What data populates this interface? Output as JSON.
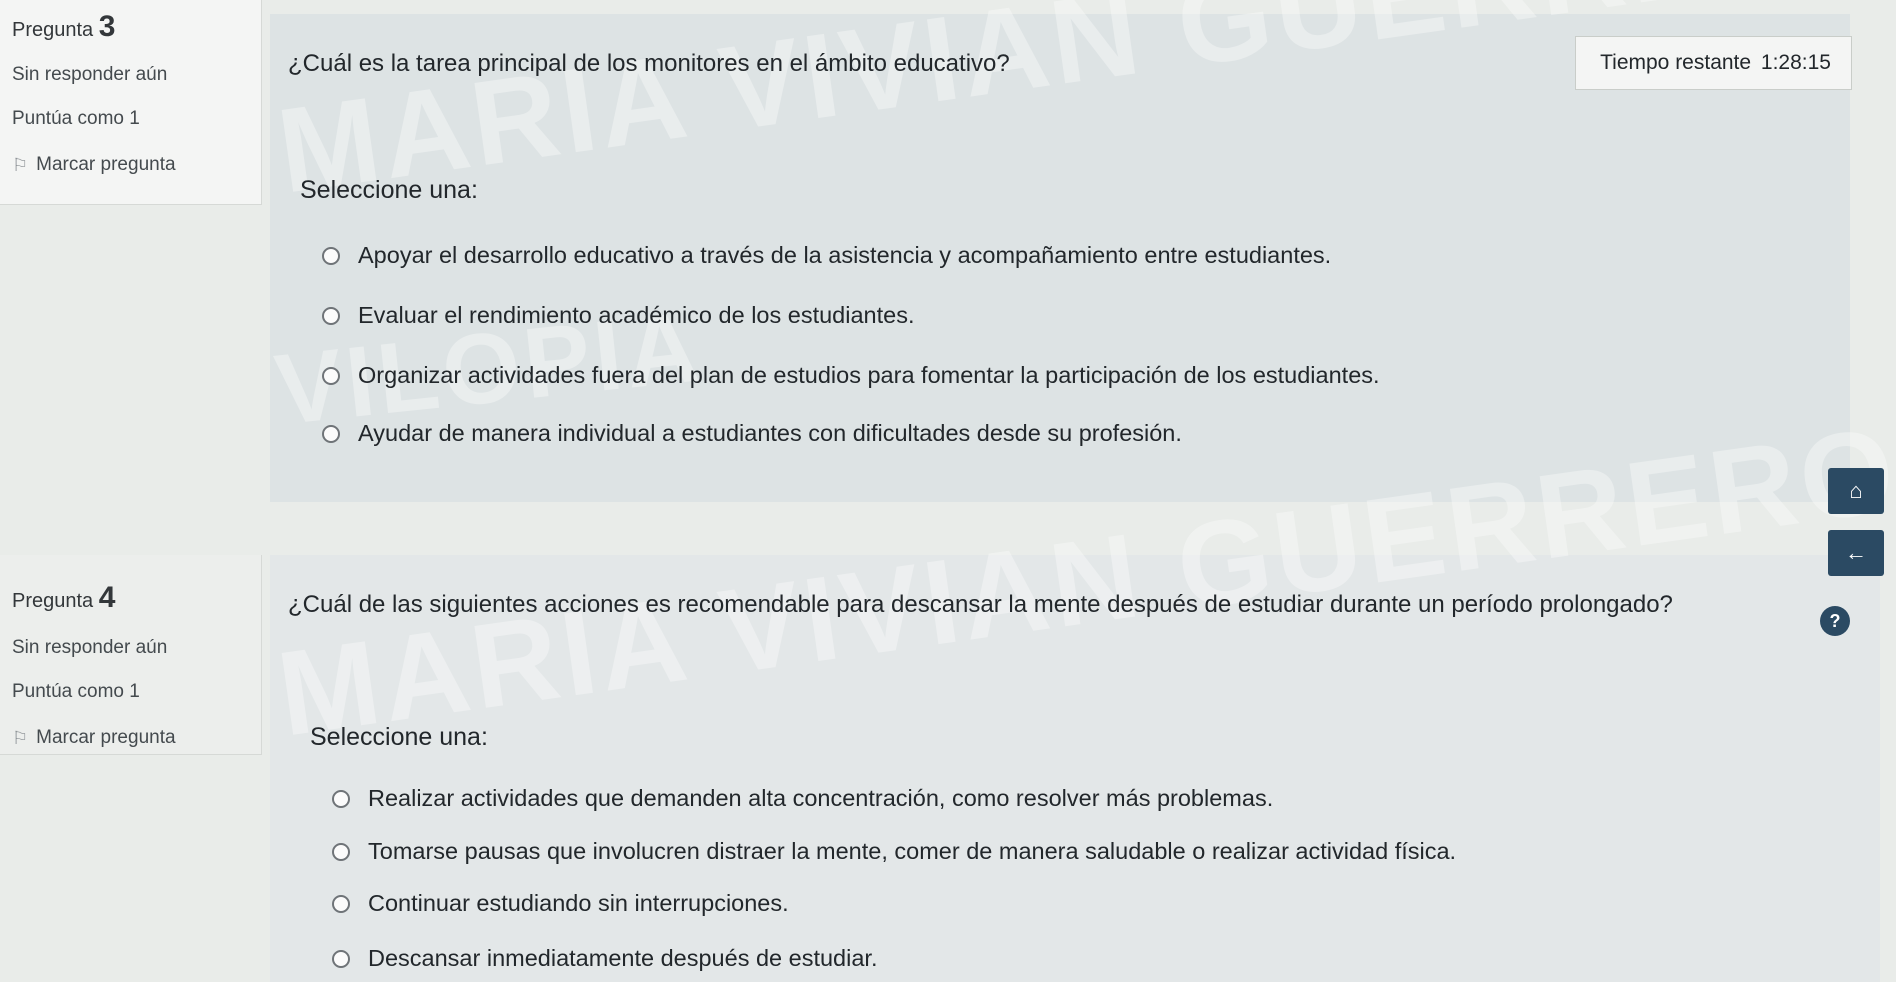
{
  "timer": {
    "label": "Tiempo restante",
    "value": "1:28:15"
  },
  "watermark": {
    "text1": "MARIA VIVIAN GUERRERO",
    "text2": "VILOPIA"
  },
  "q3": {
    "label": "Pregunta",
    "number": "3",
    "status": "Sin responder aún",
    "score": "Puntúa como 1",
    "flag": "Marcar pregunta",
    "question": "¿Cuál es la tarea principal de los monitores en el ámbito educativo?",
    "select_label": "Seleccione una:",
    "options": [
      "Apoyar el desarrollo educativo a través de la asistencia y acompañamiento entre estudiantes.",
      "Evaluar el rendimiento académico de los estudiantes.",
      "Organizar actividades fuera del plan de estudios para fomentar la participación de los estudiantes.",
      "Ayudar de manera individual a estudiantes con dificultades desde su profesión."
    ]
  },
  "q4": {
    "label": "Pregunta",
    "number": "4",
    "status": "Sin responder aún",
    "score": "Puntúa como 1",
    "flag": "Marcar pregunta",
    "question": "¿Cuál de las siguientes acciones es recomendable para descansar la mente después de estudiar durante un período prolongado?",
    "select_label": "Seleccione una:",
    "options": [
      "Realizar actividades que demanden alta concentración, como resolver más problemas.",
      "Tomarse pausas que involucren distraer la mente, comer de manera saludable o realizar actividad física.",
      "Continuar estudiando sin interrupciones.",
      "Descansar inmediatamente después de estudiar."
    ]
  }
}
